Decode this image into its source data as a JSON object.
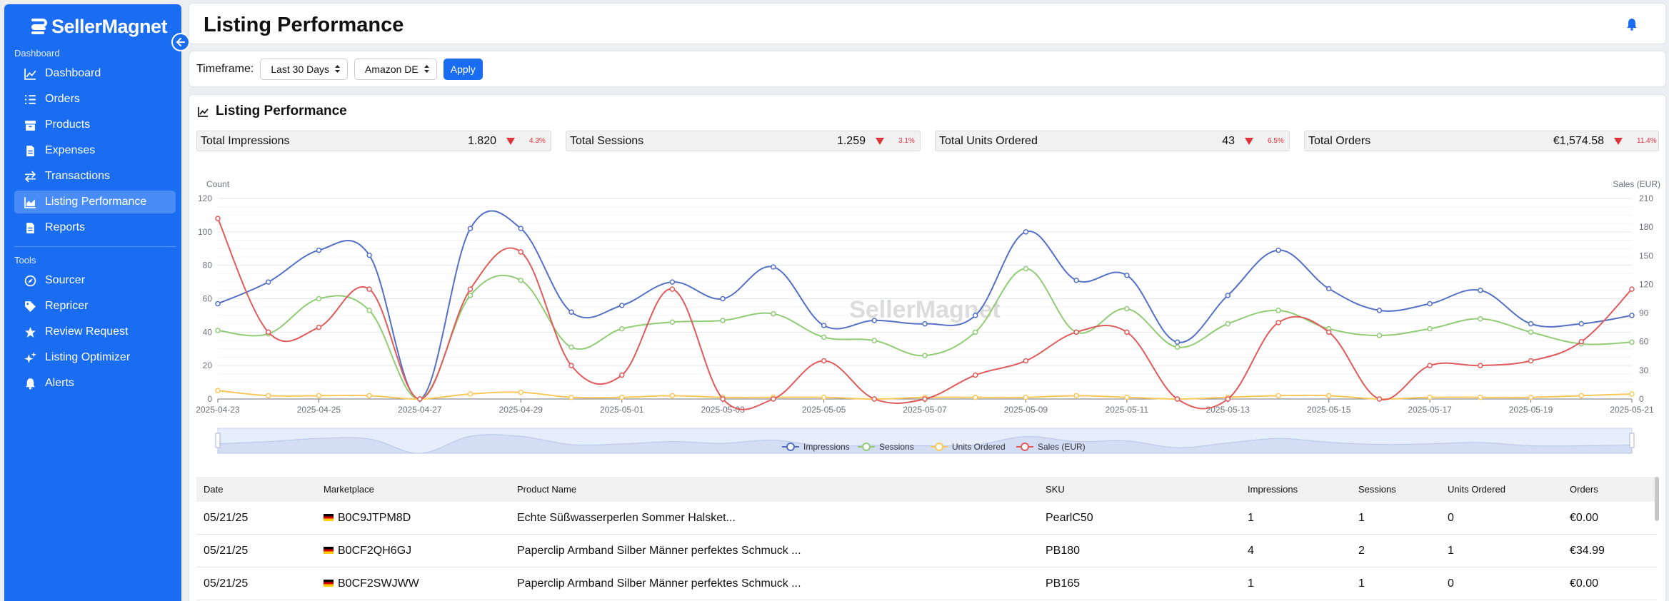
{
  "brand": {
    "name": "SellerMagnet"
  },
  "sidebar": {
    "sections": [
      {
        "label": "Dashboard",
        "items": [
          {
            "label": "Dashboard",
            "icon": "chart-line-icon"
          },
          {
            "label": "Orders",
            "icon": "list-icon"
          },
          {
            "label": "Products",
            "icon": "box-icon"
          },
          {
            "label": "Expenses",
            "icon": "file-icon"
          },
          {
            "label": "Transactions",
            "icon": "arrows-icon"
          },
          {
            "label": "Listing Performance",
            "icon": "chart-area-icon",
            "active": true
          },
          {
            "label": "Reports",
            "icon": "file-icon"
          }
        ]
      },
      {
        "label": "Tools",
        "items": [
          {
            "label": "Sourcer",
            "icon": "compass-icon"
          },
          {
            "label": "Repricer",
            "icon": "tag-icon"
          },
          {
            "label": "Review Request",
            "icon": "star-icon"
          },
          {
            "label": "Listing Optimizer",
            "icon": "sparkles-icon"
          },
          {
            "label": "Alerts",
            "icon": "bell-icon"
          }
        ]
      }
    ]
  },
  "header": {
    "title": "Listing Performance"
  },
  "filters": {
    "timeframe_label": "Timeframe:",
    "timeframe_value": "Last 30 Days",
    "marketplace_value": "Amazon DE",
    "apply_label": "Apply"
  },
  "panel": {
    "title": "Listing Performance"
  },
  "kpis": [
    {
      "label": "Total Impressions",
      "value": "1.820",
      "change": "4.3%"
    },
    {
      "label": "Total Sessions",
      "value": "1.259",
      "change": "3.1%"
    },
    {
      "label": "Total Units Ordered",
      "value": "43",
      "change": "6.5%"
    },
    {
      "label": "Total Orders",
      "value": "€1,574.58",
      "change": "11.4%"
    }
  ],
  "colors": {
    "impressions": "#5470c6",
    "sessions": "#91cc75",
    "units": "#fac858",
    "sales": "#e05a5a",
    "accent": "#1a6cf0"
  },
  "chart_data": {
    "type": "line",
    "left_axis_label": "Count",
    "right_axis_label": "Sales (EUR)",
    "left_ylim": [
      0,
      120
    ],
    "right_ylim": [
      0,
      210
    ],
    "left_ticks": [
      0,
      20,
      40,
      60,
      80,
      100,
      120
    ],
    "right_ticks": [
      0,
      30,
      60,
      90,
      120,
      150,
      180,
      210
    ],
    "x_tick_labels": [
      "2025-04-23",
      "2025-04-25",
      "2025-04-27",
      "2025-04-29",
      "2025-05-01",
      "2025-05-03",
      "2025-05-05",
      "2025-05-07",
      "2025-05-09",
      "2025-05-11",
      "2025-05-13",
      "2025-05-15",
      "2025-05-17",
      "2025-05-19",
      "2025-05-21"
    ],
    "x": [
      "2025-04-23",
      "2025-04-24",
      "2025-04-25",
      "2025-04-26",
      "2025-04-27",
      "2025-04-28",
      "2025-04-29",
      "2025-04-30",
      "2025-05-01",
      "2025-05-02",
      "2025-05-03",
      "2025-05-04",
      "2025-05-05",
      "2025-05-06",
      "2025-05-07",
      "2025-05-08",
      "2025-05-09",
      "2025-05-10",
      "2025-05-11",
      "2025-05-12",
      "2025-05-13",
      "2025-05-14",
      "2025-05-15",
      "2025-05-16",
      "2025-05-17",
      "2025-05-18",
      "2025-05-19",
      "2025-05-20",
      "2025-05-21"
    ],
    "series": [
      {
        "name": "Impressions",
        "axis": "left",
        "values": [
          57,
          70,
          89,
          86,
          0,
          102,
          102,
          52,
          56,
          70,
          60,
          79,
          44,
          47,
          45,
          50,
          100,
          71,
          74,
          34,
          62,
          89,
          66,
          53,
          57,
          65,
          45,
          45,
          50
        ]
      },
      {
        "name": "Sessions",
        "axis": "left",
        "values": [
          41,
          39,
          60,
          53,
          0,
          62,
          71,
          31,
          42,
          46,
          47,
          51,
          37,
          35,
          26,
          40,
          78,
          40,
          54,
          31,
          45,
          53,
          42,
          38,
          42,
          48,
          40,
          33,
          34
        ]
      },
      {
        "name": "Units Ordered",
        "axis": "left",
        "values": [
          5,
          2,
          2,
          2,
          0,
          3,
          4,
          1,
          1,
          2,
          1,
          1,
          1,
          0,
          1,
          1,
          1,
          2,
          1,
          0,
          1,
          2,
          2,
          0,
          1,
          1,
          1,
          2,
          3
        ]
      },
      {
        "name": "Sales (EUR)",
        "axis": "right",
        "values": [
          189,
          70,
          75,
          115,
          0,
          115,
          154,
          35,
          25,
          115,
          0,
          0,
          40,
          0,
          0,
          25,
          40,
          70,
          70,
          0,
          0,
          80,
          70,
          0,
          35,
          35,
          40,
          60,
          115
        ]
      }
    ],
    "watermark": "SellerMagnet"
  },
  "table": {
    "headers": [
      "Date",
      "Marketplace",
      "Product Name",
      "SKU",
      "Impressions",
      "Sessions",
      "Units Ordered",
      "Orders"
    ],
    "rows": [
      {
        "date": "05/21/25",
        "asin": "B0C9JTPM8D",
        "product": "Echte Süßwasserperlen Sommer Halsket...",
        "sku": "PearlC50",
        "impressions": "1",
        "sessions": "1",
        "units": "0",
        "orders": "€0.00"
      },
      {
        "date": "05/21/25",
        "asin": "B0CF2QH6GJ",
        "product": "Paperclip Armband Silber Männer perfektes Schmuck ...",
        "sku": "PB180",
        "impressions": "4",
        "sessions": "2",
        "units": "1",
        "orders": "€34.99"
      },
      {
        "date": "05/21/25",
        "asin": "B0CF2SWJWW",
        "product": "Paperclip Armband Silber Männer perfektes Schmuck ...",
        "sku": "PB165",
        "impressions": "1",
        "sessions": "1",
        "units": "0",
        "orders": "€0.00"
      }
    ]
  }
}
